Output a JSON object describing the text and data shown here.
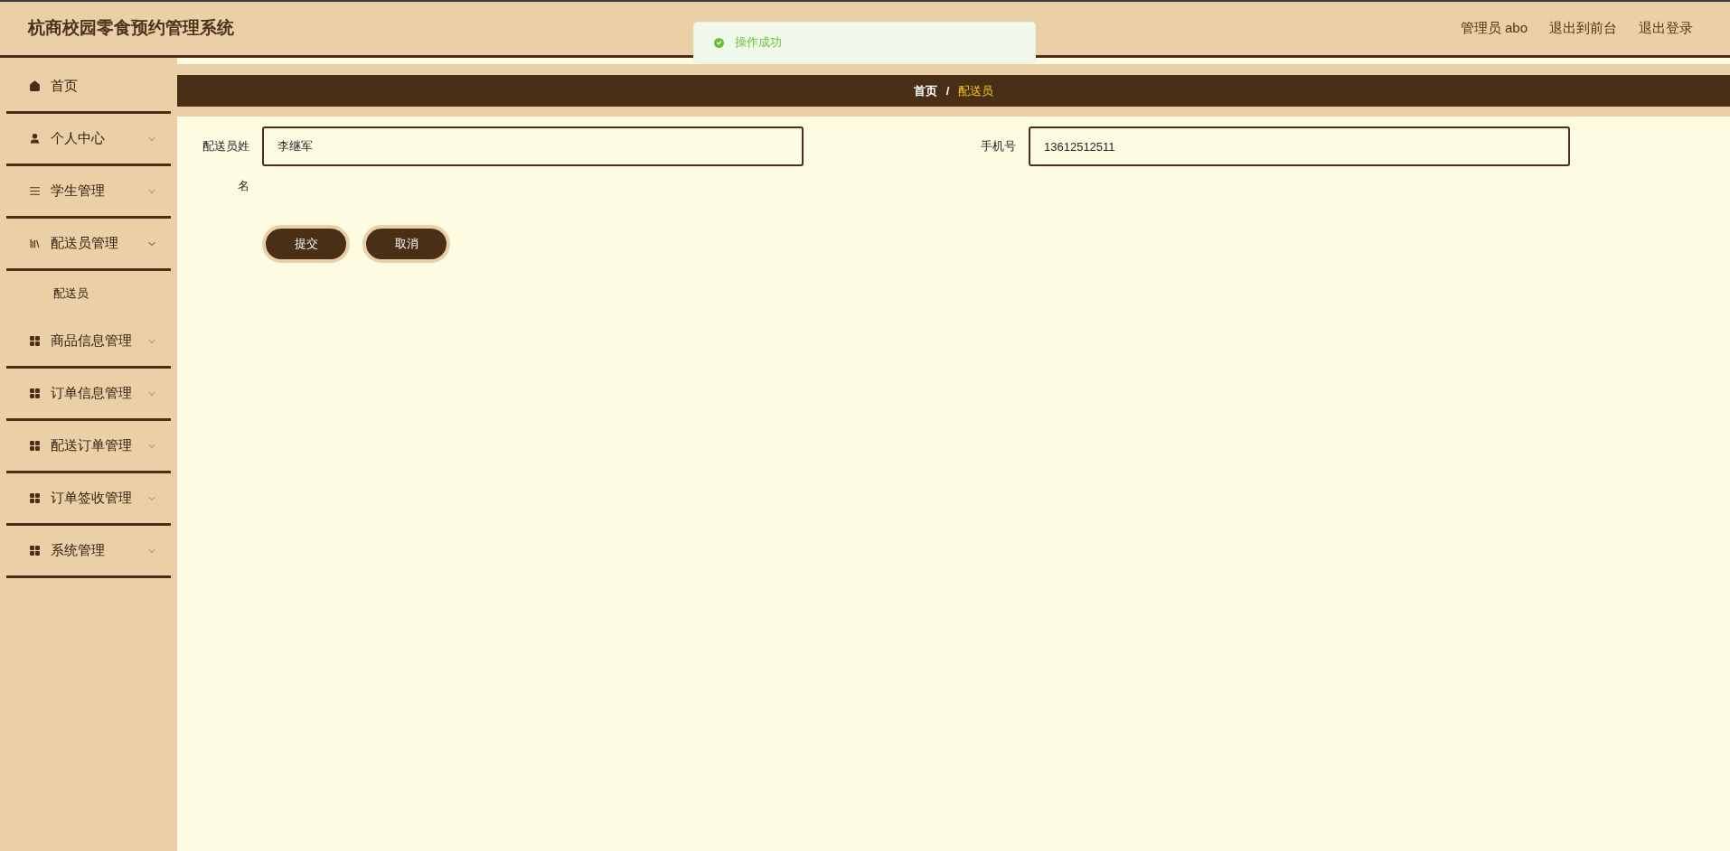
{
  "header": {
    "title": "杭商校园零食预约管理系统",
    "links": [
      "管理员 abo",
      "退出到前台",
      "退出登录"
    ]
  },
  "toast": {
    "message": "操作成功"
  },
  "sidebar": {
    "items": [
      {
        "label": "首页",
        "kind": "link"
      },
      {
        "label": "个人中心",
        "kind": "menu",
        "expanded": false
      },
      {
        "label": "学生管理",
        "kind": "menu",
        "expanded": false
      },
      {
        "label": "配送员管理",
        "kind": "menu",
        "expanded": true,
        "children": [
          {
            "label": "配送员"
          }
        ]
      },
      {
        "label": "商品信息管理",
        "kind": "menu",
        "expanded": false
      },
      {
        "label": "订单信息管理",
        "kind": "menu",
        "expanded": false
      },
      {
        "label": "配送订单管理",
        "kind": "menu",
        "expanded": false
      },
      {
        "label": "订单签收管理",
        "kind": "menu",
        "expanded": false
      },
      {
        "label": "系统管理",
        "kind": "menu",
        "expanded": false
      }
    ]
  },
  "breadcrumb": {
    "items": [
      "首页",
      "配送员"
    ],
    "separator": "/"
  },
  "form": {
    "fields": [
      {
        "label": "配送员姓名",
        "value": "李继军"
      },
      {
        "label": "手机号",
        "value": "13612512511"
      }
    ],
    "buttons": [
      "提交",
      "取消"
    ]
  }
}
